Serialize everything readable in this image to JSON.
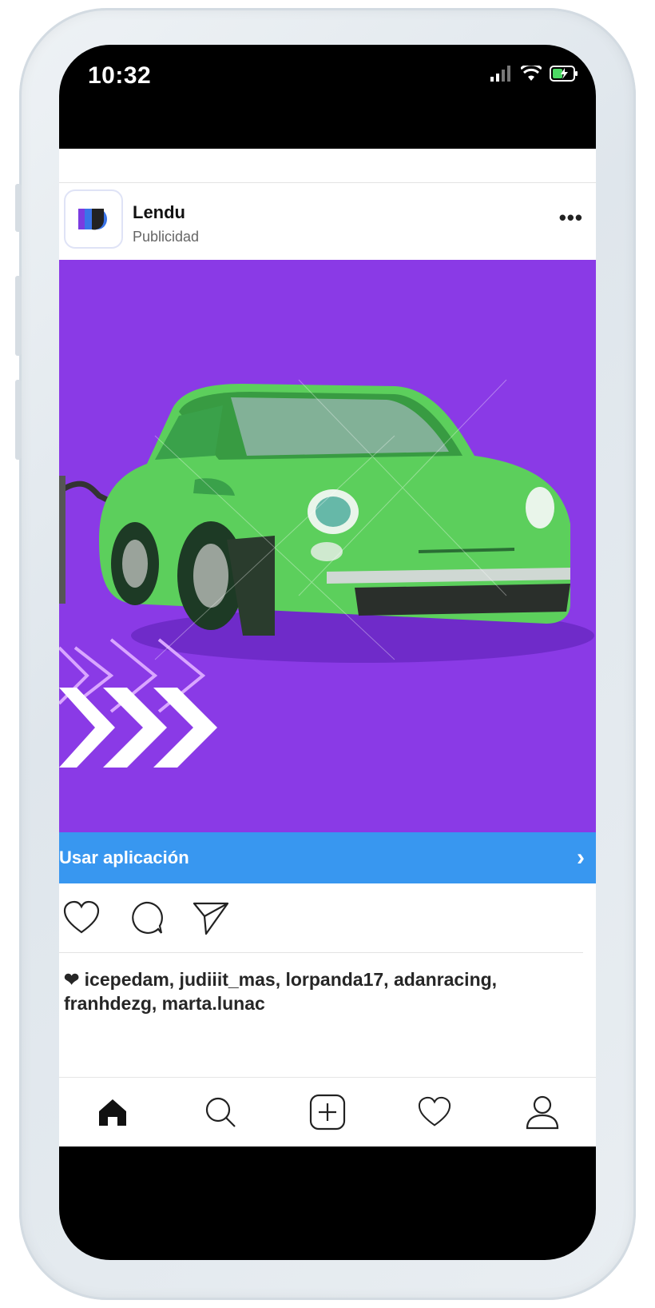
{
  "status_bar": {
    "time": "10:32"
  },
  "post": {
    "brand_name": "Lendu",
    "sponsored_label": "Publicidad",
    "more_label": "•••"
  },
  "cta": {
    "label": "Usar aplicación",
    "arrow": "›"
  },
  "likes": {
    "heart": "❤",
    "text": "icepedam, judiiit_mas, lorpanda17, adanracing, franhdezg, marta.lunac"
  },
  "tab_bar": {
    "items": [
      "home-icon",
      "search-icon",
      "add-icon",
      "heart-icon",
      "profile-icon"
    ]
  },
  "colors": {
    "ad_background": "#8a3ae6",
    "car_green": "#5ccf5c",
    "cta_blue": "#3897f0"
  }
}
